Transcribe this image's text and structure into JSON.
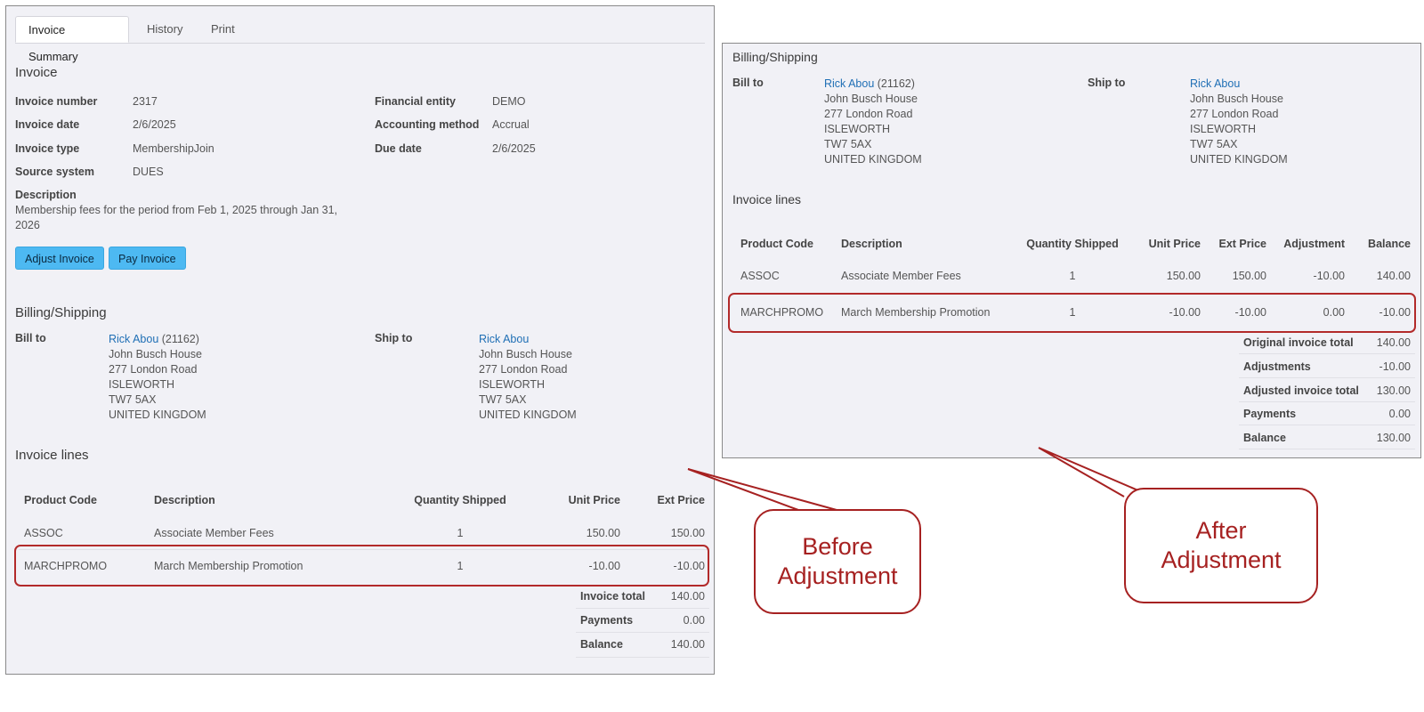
{
  "tabs": [
    {
      "label": "Invoice Summary",
      "active": true
    },
    {
      "label": "History",
      "active": false
    },
    {
      "label": "Print",
      "active": false
    }
  ],
  "invoice": {
    "heading": "Invoice",
    "fields_left": [
      {
        "label": "Invoice number",
        "value": "2317"
      },
      {
        "label": "Invoice date",
        "value": "2/6/2025"
      },
      {
        "label": "Invoice type",
        "value": "MembershipJoin"
      },
      {
        "label": "Source system",
        "value": "DUES"
      }
    ],
    "fields_right": [
      {
        "label": "Financial entity",
        "value": "DEMO"
      },
      {
        "label": "Accounting method",
        "value": "Accrual"
      },
      {
        "label": "Due date",
        "value": "2/6/2025"
      }
    ],
    "description_label": "Description",
    "description_line1": "Membership fees for the period from Feb 1, 2025 through Jan 31,",
    "description_line2": "2026",
    "adjust_button": "Adjust Invoice",
    "pay_button": "Pay Invoice"
  },
  "billing": {
    "heading": "Billing/Shipping",
    "bill_to_label": "Bill to",
    "ship_to_label": "Ship to",
    "bill_name": "Rick Abou",
    "bill_id": "(21162)",
    "ship_name": "Rick Abou",
    "address": [
      "John Busch House",
      "277 London Road",
      "ISLEWORTH",
      "TW7 5AX",
      "UNITED KINGDOM"
    ]
  },
  "lines_heading": "Invoice lines",
  "before": {
    "headers": [
      "Product Code",
      "Description",
      "Quantity Shipped",
      "Unit Price",
      "Ext Price"
    ],
    "rows": [
      [
        "ASSOC",
        "Associate Member Fees",
        "1",
        "150.00",
        "150.00"
      ],
      [
        "MARCHPROMO",
        "March Membership Promotion",
        "1",
        "-10.00",
        "-10.00"
      ]
    ],
    "totals": [
      {
        "label": "Invoice total",
        "value": "140.00"
      },
      {
        "label": "Payments",
        "value": "0.00"
      },
      {
        "label": "Balance",
        "value": "140.00"
      }
    ]
  },
  "after": {
    "headers": [
      "Product Code",
      "Description",
      "Quantity Shipped",
      "Unit Price",
      "Ext Price",
      "Adjustment",
      "Balance"
    ],
    "rows": [
      [
        "ASSOC",
        "Associate Member Fees",
        "1",
        "150.00",
        "150.00",
        "-10.00",
        "140.00"
      ],
      [
        "MARCHPROMO",
        "March Membership Promotion",
        "1",
        "-10.00",
        "-10.00",
        "0.00",
        "-10.00"
      ]
    ],
    "totals": [
      {
        "label": "Original invoice total",
        "value": "140.00"
      },
      {
        "label": "Adjustments",
        "value": "-10.00"
      },
      {
        "label": "Adjusted invoice total",
        "value": "130.00"
      },
      {
        "label": "Payments",
        "value": "0.00"
      },
      {
        "label": "Balance",
        "value": "130.00"
      }
    ]
  },
  "callouts": {
    "before_line1": "Before",
    "before_line2": "Adjustment",
    "after_line1": "After",
    "after_line2": "Adjustment"
  },
  "colors": {
    "accent": "#4db9f2",
    "link": "#1f6fb5",
    "callout": "#a62121"
  }
}
